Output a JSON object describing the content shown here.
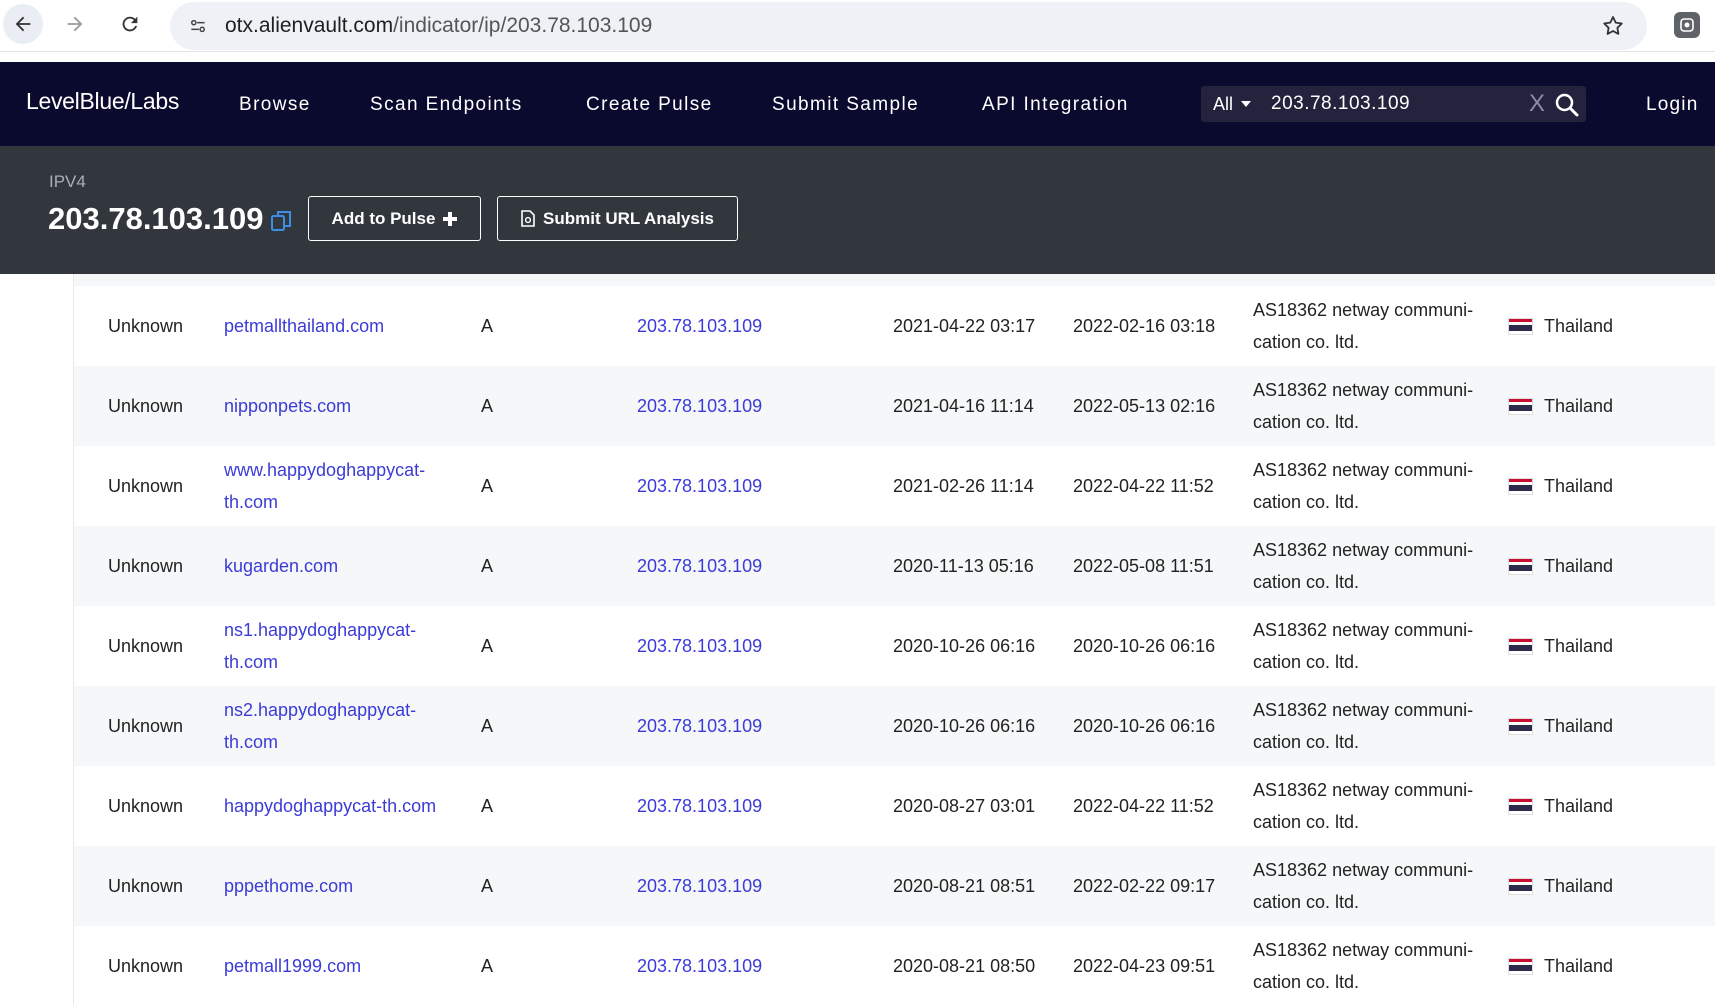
{
  "browser": {
    "url_host": "otx.alienvault.com",
    "url_path": "/indicator/ip/203.78.103.109"
  },
  "header": {
    "logo": "LevelBlue/Labs",
    "menu": [
      "Browse",
      "Scan Endpoints",
      "Create Pulse",
      "Submit Sample",
      "API Integration"
    ],
    "search_scope": "All",
    "search_value": "203.78.103.109",
    "login": "Login"
  },
  "indicator": {
    "type": "IPV4",
    "value": "203.78.103.109",
    "add_to_pulse": "Add to Pulse",
    "submit_url": "Submit URL Analysis"
  },
  "table": {
    "rows": [
      {
        "status": "Unknown",
        "hostname": [
          "petmallthailand.com"
        ],
        "type": "A",
        "address": "203.78.103.109",
        "first_seen": "2021-04-22 03:17",
        "last_seen": "2022-02-16 03:18",
        "asn": [
          "AS18362 netway communi-",
          "cation co. ltd."
        ],
        "country": "Thailand"
      },
      {
        "status": "Unknown",
        "hostname": [
          "nipponpets.com"
        ],
        "type": "A",
        "address": "203.78.103.109",
        "first_seen": "2021-04-16 11:14",
        "last_seen": "2022-05-13 02:16",
        "asn": [
          "AS18362 netway communi-",
          "cation co. ltd."
        ],
        "country": "Thailand"
      },
      {
        "status": "Unknown",
        "hostname": [
          "www.happydoghappycat-",
          "th.com"
        ],
        "type": "A",
        "address": "203.78.103.109",
        "first_seen": "2021-02-26 11:14",
        "last_seen": "2022-04-22 11:52",
        "asn": [
          "AS18362 netway communi-",
          "cation co. ltd."
        ],
        "country": "Thailand"
      },
      {
        "status": "Unknown",
        "hostname": [
          "kugarden.com"
        ],
        "type": "A",
        "address": "203.78.103.109",
        "first_seen": "2020-11-13 05:16",
        "last_seen": "2022-05-08 11:51",
        "asn": [
          "AS18362 netway communi-",
          "cation co. ltd."
        ],
        "country": "Thailand"
      },
      {
        "status": "Unknown",
        "hostname": [
          "ns1.happydoghappycat-",
          "th.com"
        ],
        "type": "A",
        "address": "203.78.103.109",
        "first_seen": "2020-10-26 06:16",
        "last_seen": "2020-10-26 06:16",
        "asn": [
          "AS18362 netway communi-",
          "cation co. ltd."
        ],
        "country": "Thailand"
      },
      {
        "status": "Unknown",
        "hostname": [
          "ns2.happydoghappycat-",
          "th.com"
        ],
        "type": "A",
        "address": "203.78.103.109",
        "first_seen": "2020-10-26 06:16",
        "last_seen": "2020-10-26 06:16",
        "asn": [
          "AS18362 netway communi-",
          "cation co. ltd."
        ],
        "country": "Thailand"
      },
      {
        "status": "Unknown",
        "hostname": [
          "happydoghappycat-th.com"
        ],
        "type": "A",
        "address": "203.78.103.109",
        "first_seen": "2020-08-27 03:01",
        "last_seen": "2022-04-22 11:52",
        "asn": [
          "AS18362 netway communi-",
          "cation co. ltd."
        ],
        "country": "Thailand"
      },
      {
        "status": "Unknown",
        "hostname": [
          "pppethome.com"
        ],
        "type": "A",
        "address": "203.78.103.109",
        "first_seen": "2020-08-21 08:51",
        "last_seen": "2022-02-22 09:17",
        "asn": [
          "AS18362 netway communi-",
          "cation co. ltd."
        ],
        "country": "Thailand"
      },
      {
        "status": "Unknown",
        "hostname": [
          "petmall1999.com"
        ],
        "type": "A",
        "address": "203.78.103.109",
        "first_seen": "2020-08-21 08:50",
        "last_seen": "2022-04-23 09:51",
        "asn": [
          "AS18362 netway communi-",
          "cation co. ltd."
        ],
        "country": "Thailand"
      }
    ]
  }
}
